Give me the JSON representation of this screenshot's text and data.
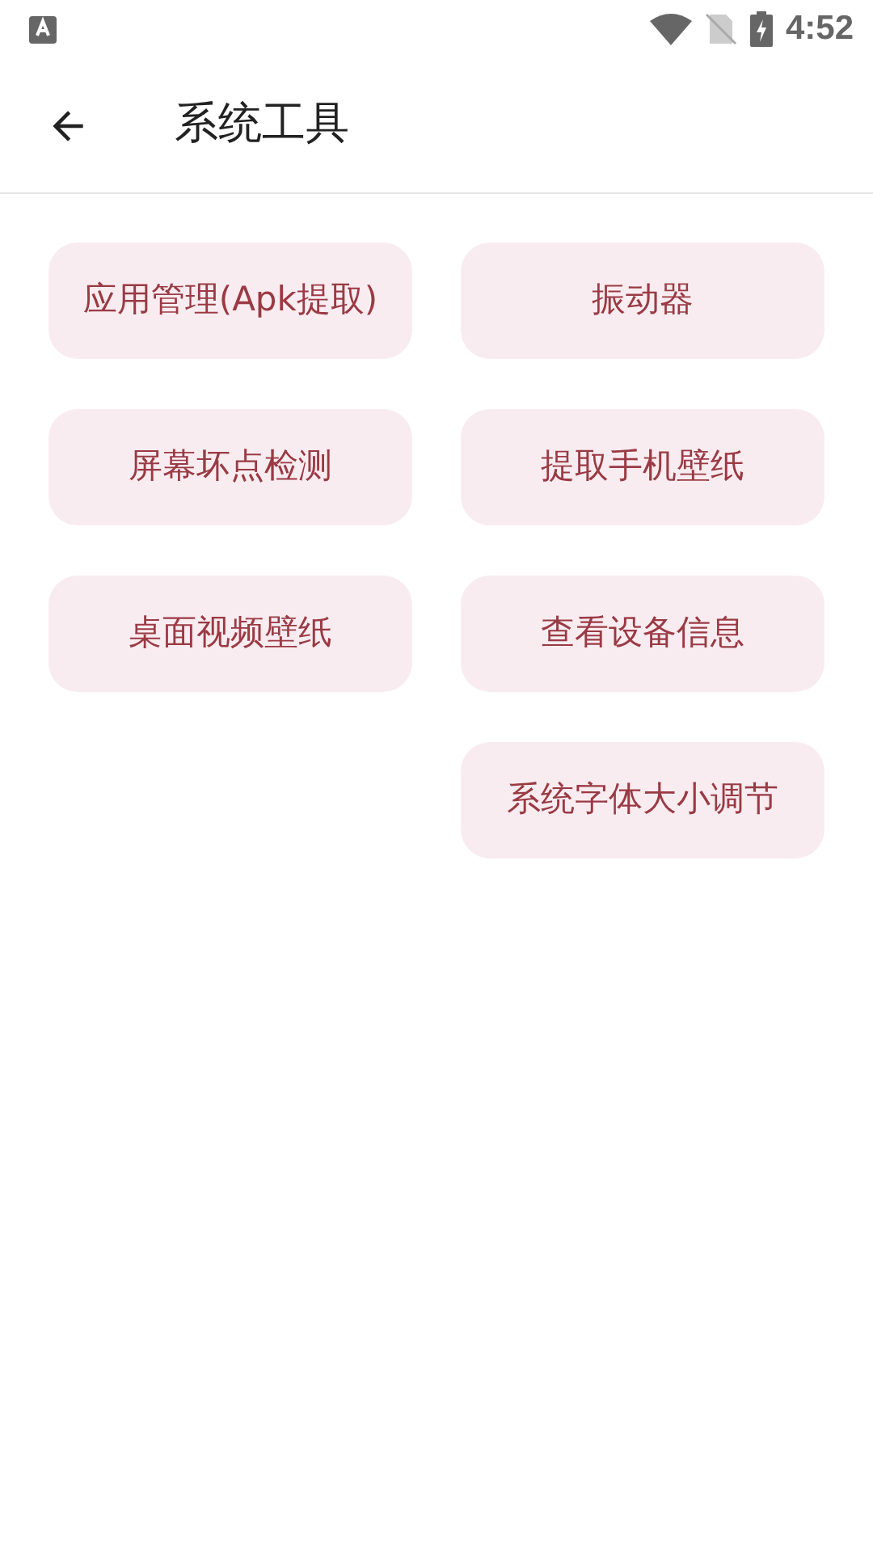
{
  "status_bar": {
    "time": "4:52"
  },
  "app_bar": {
    "title": "系统工具"
  },
  "columns": [
    {
      "buttons": [
        "应用管理(Apk提取)",
        "屏幕坏点检测",
        "桌面视频壁纸"
      ]
    },
    {
      "buttons": [
        "振动器",
        "提取手机壁纸",
        "查看设备信息",
        "系统字体大小调节"
      ]
    }
  ]
}
